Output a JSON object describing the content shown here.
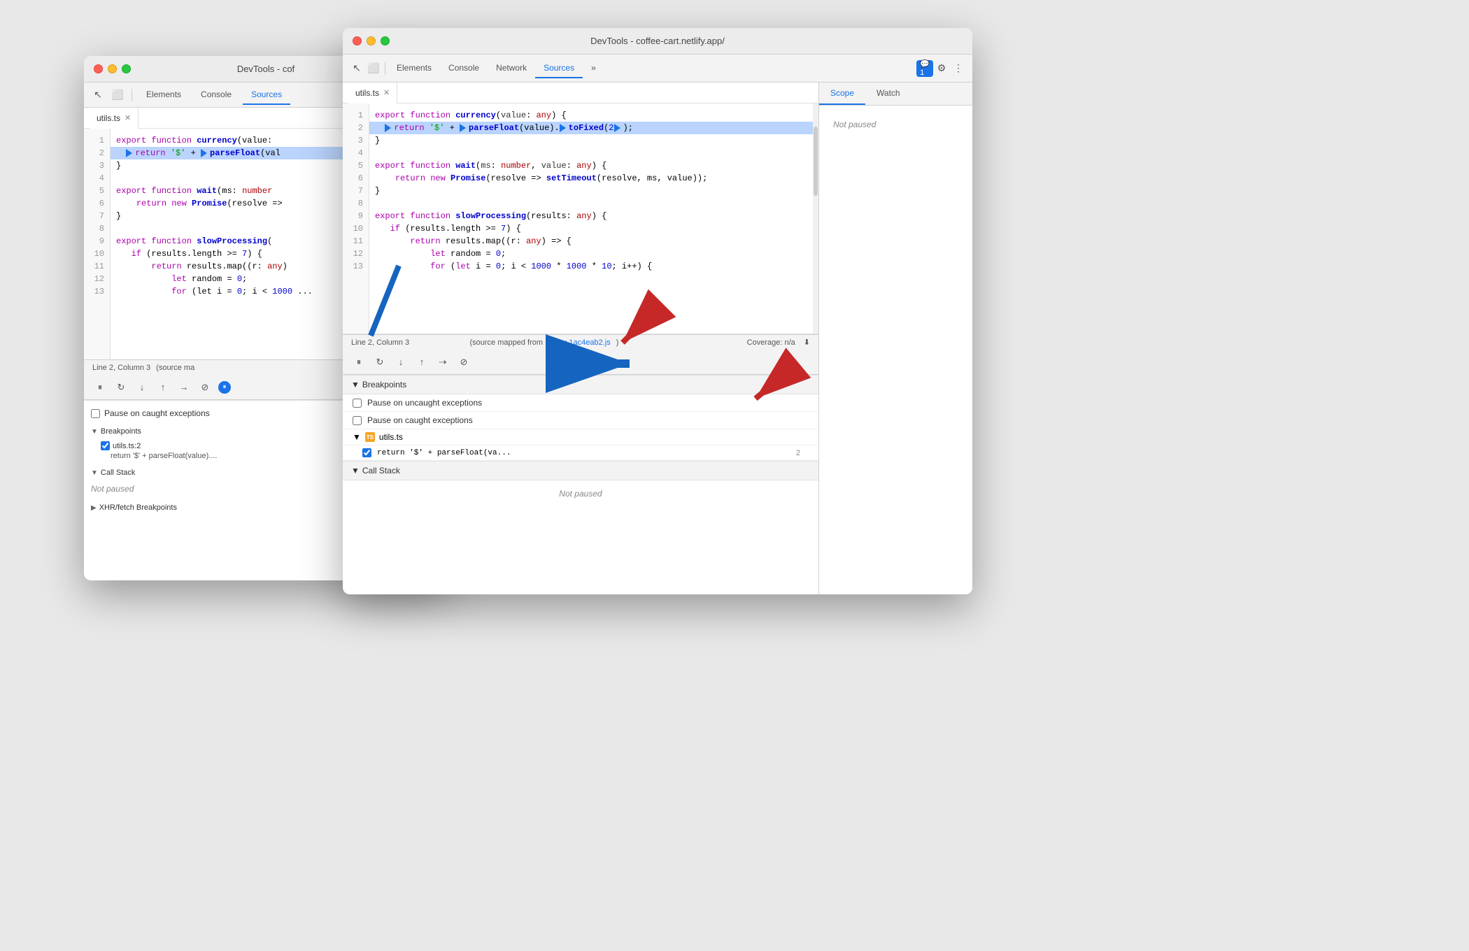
{
  "bg_window": {
    "title": "DevTools - cof",
    "tabs": [
      "Elements",
      "Console",
      "Sources"
    ],
    "active_tab": "Sources",
    "file_tab": "utils.ts",
    "code_lines": [
      {
        "num": 1,
        "text": "export function currency(value: ",
        "highlight": false
      },
      {
        "num": 2,
        "text": "  ▶return '$' + ▶parseFloat(val",
        "highlight": true
      },
      {
        "num": 3,
        "text": "}",
        "highlight": false
      },
      {
        "num": 4,
        "text": "",
        "highlight": false
      },
      {
        "num": 5,
        "text": "export function wait(ms: number",
        "highlight": false
      },
      {
        "num": 6,
        "text": "    return new Promise(resolve =>",
        "highlight": false
      },
      {
        "num": 7,
        "text": "}",
        "highlight": false
      },
      {
        "num": 8,
        "text": "",
        "highlight": false
      },
      {
        "num": 9,
        "text": "export function slowProcessing(",
        "highlight": false
      },
      {
        "num": 10,
        "text": "   if (results.length >= 7) {",
        "highlight": false
      },
      {
        "num": 11,
        "text": "       return results.map((r: any)",
        "highlight": false
      },
      {
        "num": 12,
        "text": "           let random = 0;",
        "highlight": false
      },
      {
        "num": 13,
        "text": "           for (let i = 0; i < 1000 ...",
        "highlight": false
      }
    ],
    "status": "Line 2, Column 3",
    "status_right": "(source ma",
    "pause_on_caught": "Pause on caught exceptions",
    "breakpoints_label": "Breakpoints",
    "bp_file": "utils.ts:2",
    "bp_detail": "return '$' + parseFloat(value)....",
    "call_stack_label": "Call Stack",
    "not_paused": "Not paused",
    "xhr_label": "XHR/fetch Breakpoints"
  },
  "fg_window": {
    "title": "DevTools - coffee-cart.netlify.app/",
    "tabs": [
      "Elements",
      "Console",
      "Network",
      "Sources"
    ],
    "active_tab": "Sources",
    "file_tab": "utils.ts",
    "code_lines": [
      {
        "num": 1,
        "text": "export function currency(value: any) {",
        "highlight": false
      },
      {
        "num": 2,
        "text": "  ▶return '$' + ▶parseFloat(value).▶toFixed(2▶);",
        "highlight": true
      },
      {
        "num": 3,
        "text": "}",
        "highlight": false
      },
      {
        "num": 4,
        "text": "",
        "highlight": false
      },
      {
        "num": 5,
        "text": "export function wait(ms: number, value: any) {",
        "highlight": false
      },
      {
        "num": 6,
        "text": "    return new Promise(resolve => setTimeout(resolve, ms, value));",
        "highlight": false
      },
      {
        "num": 7,
        "text": "}",
        "highlight": false
      },
      {
        "num": 8,
        "text": "",
        "highlight": false
      },
      {
        "num": 9,
        "text": "export function slowProcessing(results: any) {",
        "highlight": false
      },
      {
        "num": 10,
        "text": "   if (results.length >= 7) {",
        "highlight": false
      },
      {
        "num": 11,
        "text": "       return results.map((r: any) => {",
        "highlight": false
      },
      {
        "num": 12,
        "text": "           let random = 0;",
        "highlight": false
      },
      {
        "num": 13,
        "text": "           for (let i = 0; i < 1000 * 1000 * 10; i++) {",
        "highlight": false
      }
    ],
    "status": "Line 2, Column 3",
    "status_mid": "(source mapped from",
    "status_link": "index.1ac4eab2.js",
    "status_right": "Coverage: n/a",
    "breakpoints_popup": {
      "header": "Breakpoints",
      "pause_uncaught": "Pause on uncaught exceptions",
      "pause_caught": "Pause on caught exceptions",
      "file": "utils.ts",
      "bp_detail": "return '$' + parseFloat(va...",
      "bp_line": "2",
      "call_stack": "Call Stack",
      "not_paused": "Not paused"
    },
    "scope_tabs": [
      "Scope",
      "Watch"
    ],
    "active_scope_tab": "Scope",
    "not_paused": "Not paused",
    "debug_buttons": [
      "pause",
      "step-over",
      "step-into",
      "step-out",
      "continue",
      "deactivate",
      "async"
    ]
  },
  "icons": {
    "close": "✕",
    "arrow_right": "▶",
    "arrow_down": "▼",
    "pause": "⏸",
    "step_over": "↷",
    "step_into": "↓",
    "step_out": "↑",
    "deactivate": "⊘",
    "more": "»",
    "settings": "⚙",
    "menu": "⋮",
    "chat": "💬",
    "cursor": "↖",
    "frames": "⬜"
  },
  "colors": {
    "accent_blue": "#1a73e8",
    "highlight_bg": "#bad4fd",
    "keyword_purple": "#aa00aa",
    "function_blue": "#0000cc",
    "type_red": "#aa0000",
    "string_green": "#009900",
    "number_blue": "#0066cc",
    "orange_icon": "#f5a623"
  }
}
